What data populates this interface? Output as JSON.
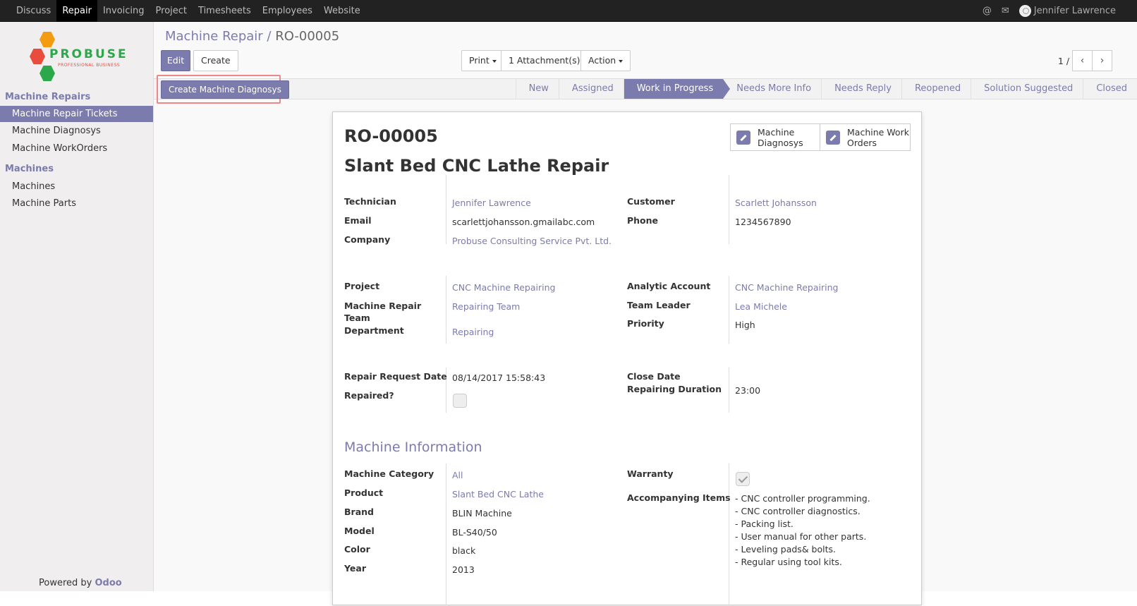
{
  "topbar": {
    "menu": [
      "Discuss",
      "Repair",
      "Invoicing",
      "Project",
      "Timesheets",
      "Employees",
      "Website"
    ],
    "active": "Repair",
    "user": "Jennifer Lawrence",
    "icons": [
      "at-icon",
      "chat-icon"
    ]
  },
  "logo": {
    "word": "PROBUSE",
    "tagline": "PROFESSIONAL BUSINESS"
  },
  "sidebar": {
    "section1": "Machine Repairs",
    "items1": [
      "Machine Repair Tickets",
      "Machine Diagnosys",
      "Machine WorkOrders"
    ],
    "section2": "Machines",
    "items2": [
      "Machines",
      "Machine Parts"
    ],
    "powered_prefix": "Powered by",
    "powered_brand": "Odoo"
  },
  "breadcrumb": {
    "parent": "Machine Repair /",
    "current": "RO-00005"
  },
  "toolbar": {
    "edit": "Edit",
    "create": "Create",
    "print": "Print",
    "attachments": "1 Attachment(s)",
    "action": "Action",
    "pager": "1 / 1"
  },
  "statusbar": {
    "diag_button": "Create Machine Diagnosys",
    "stages": [
      "New",
      "Assigned",
      "Work in Progress",
      "Needs More Info",
      "Needs Reply",
      "Reopened",
      "Solution Suggested",
      "Closed"
    ],
    "current": "Work in Progress"
  },
  "smart_buttons": {
    "diagnosys": [
      "Machine",
      "Diagnosys"
    ],
    "workorders": [
      "Machine Work",
      "Orders"
    ]
  },
  "record": {
    "ref": "RO-00005",
    "title": "Slant Bed CNC Lathe Repair",
    "fields": {
      "technician_label": "Technician",
      "technician": "Jennifer Lawrence",
      "email_label": "Email",
      "email": "scarlettjohansson.gmailabc.com",
      "company_label": "Company",
      "company": "Probuse Consulting Service Pvt. Ltd.",
      "customer_label": "Customer",
      "customer": "Scarlett Johansson",
      "phone_label": "Phone",
      "phone": "1234567890",
      "project_label": "Project",
      "project": "CNC Machine Repairing",
      "team_label_1": "Machine Repair",
      "team_label_2": "Team",
      "team": "Repairing Team",
      "department_label": "Department",
      "department": "Repairing",
      "analytic_label": "Analytic Account",
      "analytic": "CNC Machine Repairing",
      "leader_label": "Team Leader",
      "leader": "Lea Michele",
      "priority_label": "Priority",
      "priority": "High",
      "request_date_label": "Repair Request Date",
      "request_date": "08/14/2017 15:58:43",
      "repaired_label": "Repaired?",
      "close_date_label": "Close Date",
      "duration_label": "Repairing Duration",
      "duration": "23:00"
    },
    "machine": {
      "section": "Machine Information",
      "category_label": "Machine Category",
      "category": "All",
      "product_label": "Product",
      "product": "Slant Bed CNC Lathe",
      "brand_label": "Brand",
      "brand": "BLIN Machine",
      "model_label": "Model",
      "model": "BL-S40/50",
      "color_label": "Color",
      "color": "black",
      "year_label": "Year",
      "year": "2013",
      "warranty_label": "Warranty",
      "items_label": "Accompanying Items",
      "items": [
        "- CNC controller programming.",
        "- CNC controller diagnostics.",
        "- Packing list.",
        "- User manual for other parts.",
        "- Leveling pads& bolts.",
        "- Regular using tool kits."
      ]
    }
  },
  "colors": {
    "accent": "#7c7bad",
    "topbar": "#222222",
    "highlight": "#ee8888"
  }
}
